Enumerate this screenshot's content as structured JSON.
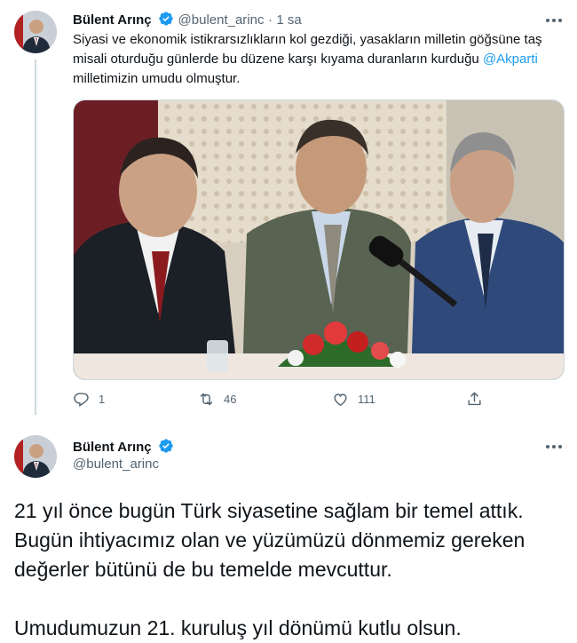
{
  "tweet1": {
    "author_name": "Bülent Arınç",
    "handle": "@bulent_arinc",
    "separator": "·",
    "time": "1 sa",
    "text_before_mention": "Siyasi ve ekonomik istikrarsızlıkların kol gezdiği, yasakların milletin göğsüne taş misali oturduğu günlerde bu düzene karşı kıyama duranların kurduğu ",
    "mention": "@Akparti",
    "text_after_mention": " milletimizin umudu olmuştur.",
    "stats": {
      "replies": "1",
      "retweets": "46",
      "likes": "111"
    }
  },
  "tweet2": {
    "author_name": "Bülent Arınç",
    "handle": "@bulent_arinc",
    "paragraph1": "21 yıl önce bugün Türk siyasetine sağlam bir temel attık. Bugün ihtiyacımız olan ve yüzümüzü dönmemiz gereken değerler bütünü de bu temelde mevcuttur.",
    "paragraph2": "Umudumuzun 21. kuruluş yıl dönümü kutlu olsun."
  },
  "icons": {
    "verified": "verified-badge-icon",
    "more": "more-icon",
    "reply": "reply-icon",
    "retweet": "retweet-icon",
    "like": "like-icon",
    "share": "share-icon"
  },
  "colors": {
    "accent": "#1d9bf0",
    "text": "#0f1419",
    "muted": "#536471",
    "thread_line": "#cfd9de"
  }
}
